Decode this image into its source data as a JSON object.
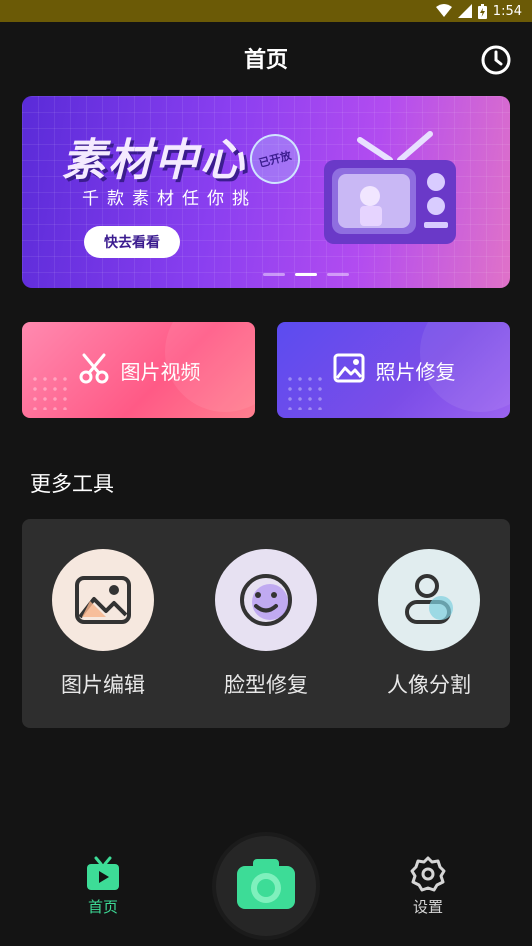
{
  "status_bar": {
    "time": "1:54"
  },
  "header": {
    "title": "首页",
    "history_icon": "clock-icon"
  },
  "banner": {
    "title": "素材中心",
    "stamp": "已开放",
    "subtitle": "千款素材任你挑",
    "button_label": "快去看看",
    "carousel_pages": 3,
    "carousel_active": 2
  },
  "feature_cards": [
    {
      "label": "图片视频",
      "icon": "scissors-icon"
    },
    {
      "label": "照片修复",
      "icon": "image-icon"
    }
  ],
  "more_tools": {
    "title": "更多工具",
    "items": [
      {
        "label": "图片编辑",
        "icon": "picture-icon"
      },
      {
        "label": "脸型修复",
        "icon": "smiley-face-icon"
      },
      {
        "label": "人像分割",
        "icon": "person-icon"
      }
    ]
  },
  "tab_bar": {
    "home_label": "首页",
    "settings_label": "设置",
    "camera_icon": "camera-icon"
  },
  "colors": {
    "accent_green": "#3ddc97",
    "background": "#141414",
    "status_bar": "#6b5a06"
  }
}
